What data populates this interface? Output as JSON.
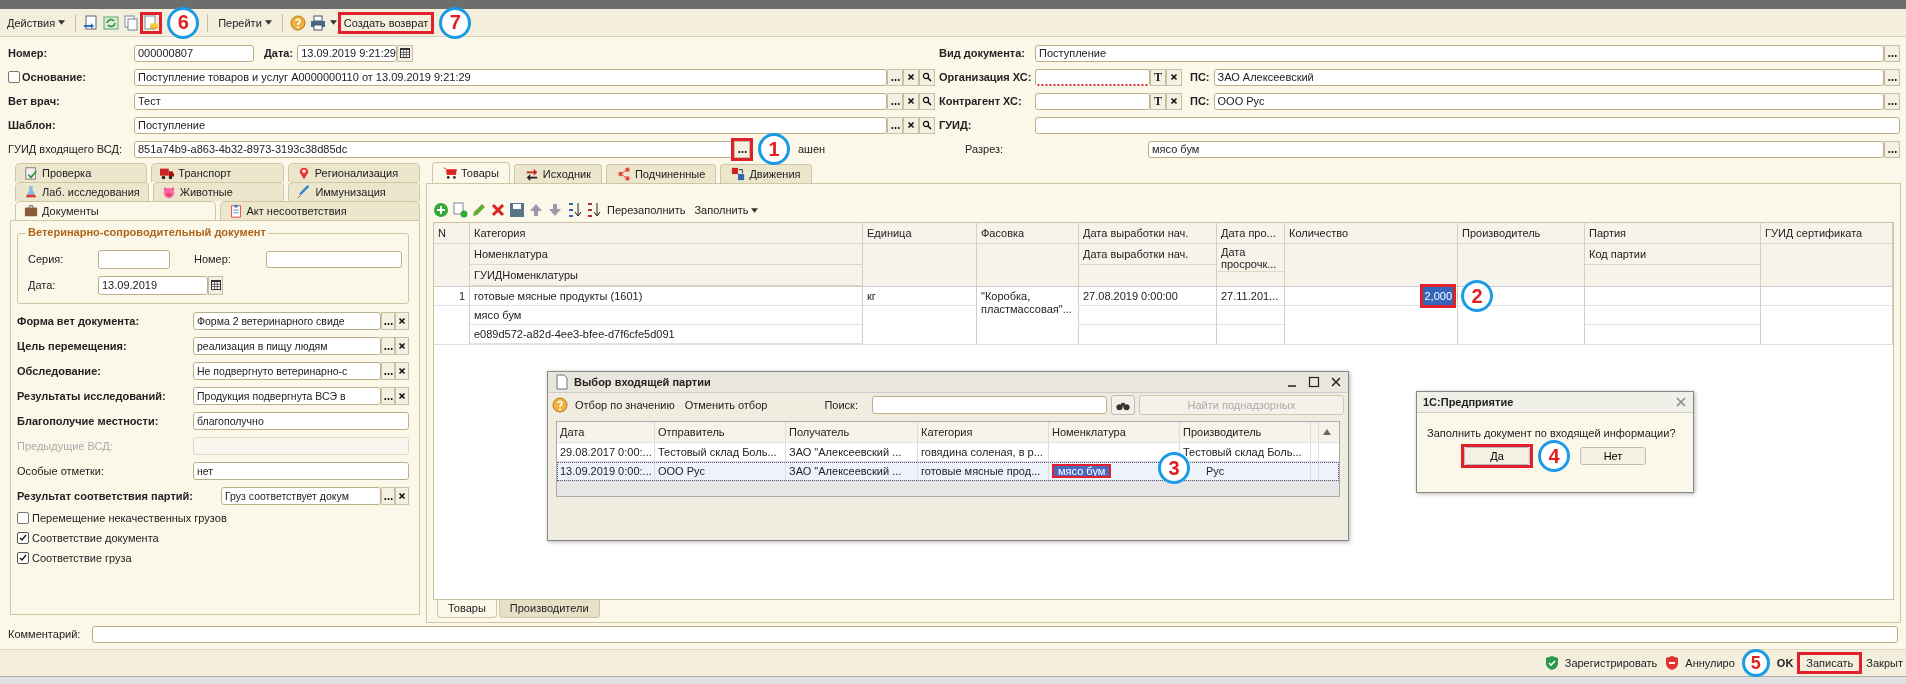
{
  "toolbar": {
    "actions_menu": "Действия",
    "goto_menu": "Перейти",
    "create_return": "Создать возврат",
    "create_return_callout": "7",
    "icon_callout": "6"
  },
  "header": {
    "number": {
      "label": "Номер:",
      "value": "000000807"
    },
    "date": {
      "label": "Дата:",
      "value": "13.09.2019 9:21:29"
    },
    "basis": {
      "label": "Основание:",
      "checked": false,
      "value": "Поступление товаров и услуг A0000000110 от 13.09.2019 9:21:29"
    },
    "fields": [
      {
        "label": "Вет врач:",
        "value": "Тест"
      },
      {
        "label": "Шаблон:",
        "value": "Поступление"
      }
    ],
    "incoming_guid": {
      "label": "ГУИД входящего ВСД:",
      "value": "851a74b9-a863-4b32-8973-3193c38d85dc",
      "callout": "1",
      "status": "ашен"
    },
    "doc_type": {
      "label": "Вид документа:",
      "value": "Поступление"
    },
    "parties": [
      {
        "label": "Организация ХС:",
        "invalid": true,
        "type_button": "Т",
        "ps_label": "ПС:",
        "ps_value": "ЗАО Алексеевский"
      },
      {
        "label": "Контрагент ХС:",
        "invalid": false,
        "type_button": "Т",
        "ps_label": "ПС:",
        "ps_value": "ООО Рус"
      }
    ],
    "guid": {
      "label": "ГУИД:"
    },
    "section": {
      "label": "Разрез:",
      "value": "мясо бум"
    }
  },
  "left_panel": {
    "tab_rows": [
      {
        "tabs": [
          {
            "label": "Проверка",
            "kind": "check",
            "selected": false
          },
          {
            "label": "Транспорт",
            "kind": "truck",
            "selected": false
          },
          {
            "label": "Регионализация",
            "kind": "pin",
            "selected": false
          }
        ]
      },
      {
        "tabs": [
          {
            "label": "Лаб. исследования",
            "kind": "flask",
            "selected": false
          },
          {
            "label": "Животные",
            "kind": "pig",
            "selected": false
          },
          {
            "label": "Иммунизация",
            "kind": "syringe",
            "selected": false
          }
        ]
      },
      {
        "tabs": [
          {
            "label": "Документы",
            "kind": "briefcase",
            "selected": true
          },
          {
            "label": "Акт несоответствия",
            "kind": "clipboard",
            "selected": false
          }
        ]
      }
    ],
    "vsd_group": {
      "title": "Ветеринарно-сопроводительный документ",
      "series_label": "Серия:",
      "number_label": "Номер:",
      "date_label": "Дата:",
      "date_value": "13.09.2019"
    },
    "rows": [
      {
        "kind": "select",
        "label": "Форма вет документа:",
        "bold": true,
        "value": "Форма 2 ветеринарного свиде"
      },
      {
        "kind": "select",
        "label": "Цель перемещения:",
        "bold": true,
        "value": "реализация в пищу людям"
      },
      {
        "kind": "select",
        "label": "Обследование:",
        "bold": true,
        "value": "Не подвергнуто ветеринарно-с"
      },
      {
        "kind": "select",
        "label": "Результаты исследований:",
        "bold": true,
        "value": "Продукция подвергнута ВСЭ в"
      },
      {
        "kind": "text",
        "label": "Благополучие местности:",
        "bold": true,
        "value": "благополучно"
      },
      {
        "kind": "disabled",
        "label": "Предыдущие ВСД:",
        "bold": false
      },
      {
        "kind": "text",
        "label": "Особые отметки:",
        "bold": false,
        "value": "нет"
      },
      {
        "kind": "wide",
        "label": "Результат соответствия партий:",
        "bold": true,
        "value": "Груз соответствует докум"
      }
    ],
    "checkboxes": [
      {
        "label": "Перемещение некачественных грузов",
        "checked": false
      },
      {
        "label": "Соответствие документа",
        "checked": true
      },
      {
        "label": "Соответствие груза",
        "checked": true
      }
    ]
  },
  "right_panel": {
    "tabs": [
      {
        "label": "Товары",
        "kind": "cart",
        "selected": true
      },
      {
        "label": "Исходник",
        "kind": "source",
        "selected": false
      },
      {
        "label": "Подчиненные",
        "kind": "nodes",
        "selected": false
      },
      {
        "label": "Движения",
        "kind": "boxes",
        "selected": false
      }
    ],
    "toolbar": {
      "refill": "Перезаполнить",
      "fill": "Заполнить"
    },
    "table": {
      "columns": [
        {
          "lines": [
            "N"
          ]
        },
        {
          "lines": [
            "Категория",
            "Номенклатура",
            "ГУИДНоменклатуры"
          ]
        },
        {
          "lines": [
            "Единица"
          ]
        },
        {
          "lines": [
            "Фасовка"
          ]
        },
        {
          "lines": [
            "Дата выработки нач.",
            "Дата выработки нач."
          ]
        },
        {
          "lines": [
            "Дата про...",
            "Дата просрочк..."
          ]
        },
        {
          "lines": [
            "Количество"
          ]
        },
        {
          "lines": [
            "Производитель"
          ]
        },
        {
          "lines": [
            "Партия",
            "Код партии"
          ]
        },
        {
          "lines": [
            "ГУИД сертификата"
          ]
        }
      ],
      "rows": [
        {
          "cells": [
            {
              "lines": [
                "1"
              ]
            },
            {
              "lines": [
                "готовые мясные продукты (1601)",
                "мясо бум",
                "e089d572-a82d-4ee3-bfee-d7f6cfe5d091"
              ]
            },
            {
              "lines": [
                "кг"
              ]
            },
            {
              "lines": [
                "\"Коробка, пластмассовая\"..."
              ]
            },
            {
              "lines": [
                "27.08.2019 0:00:00"
              ]
            },
            {
              "lines": [
                "27.11.201..."
              ]
            },
            {
              "lines": [
                "2,000"
              ],
              "selected": true,
              "callout": "2"
            },
            {},
            {},
            {}
          ]
        }
      ]
    },
    "bottom_tabs": [
      {
        "label": "Товары",
        "selected": true
      },
      {
        "label": "Производители",
        "selected": false
      }
    ]
  },
  "comment": {
    "label": "Комментарий:"
  },
  "command_bar": {
    "register": "Зарегистрировать",
    "annul": "Аннулиро",
    "ok": "OK",
    "save": "Записать",
    "save_callout": "5",
    "close": "Закрыт"
  },
  "batch_dialog": {
    "title": "Выбор входящей партии",
    "filter": "Отбор по значению",
    "cancel_filter": "Отменить отбор",
    "search_label": "Поиск:",
    "find_button": "Найти поднадзорных",
    "columns": [
      "Дата",
      "Отправитель",
      "Получатель",
      "Категория",
      "Номенклатура",
      "Производитель"
    ],
    "rows": [
      {
        "selected": false,
        "cells": [
          "29.08.2017 0:00:...",
          "Тестовый склад Боль...",
          "ЗАО \"Алексеевский ...",
          "говядина соленая, в р...",
          "",
          "Тестовый склад Боль..."
        ]
      },
      {
        "selected": true,
        "cells": [
          "13.09.2019 0:00:...",
          "ООО Рус",
          "ЗАО \"Алексеевский ...",
          "готовые мясные прод...",
          "мясо бум",
          "Рус"
        ],
        "callout": "3"
      }
    ]
  },
  "confirm_dialog": {
    "title": "1С:Предприятие",
    "message": "Заполнить документ по входящей информации?",
    "yes": "Да",
    "yes_callout": "4",
    "no": "Нет"
  }
}
